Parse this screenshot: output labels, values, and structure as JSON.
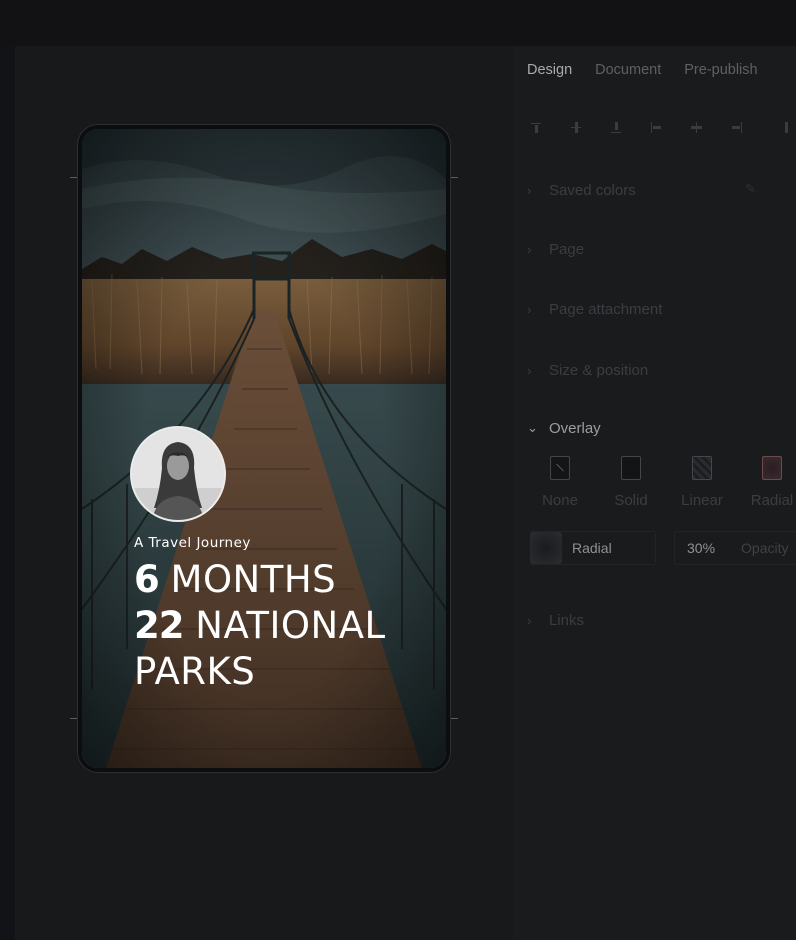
{
  "tabs": [
    {
      "label": "Design",
      "active": true
    },
    {
      "label": "Document",
      "active": false
    },
    {
      "label": "Pre-publish",
      "active": false
    }
  ],
  "toolbar": {
    "icons": [
      "align-top-icon",
      "align-middle-icon",
      "align-bottom-icon",
      "align-left-icon",
      "align-center-icon",
      "align-right-icon",
      "more-align-icon"
    ]
  },
  "sections": {
    "saved_colors": "Saved colors",
    "page": "Page",
    "page_attachment": "Page attachment",
    "size_position": "Size & position",
    "overlay": "Overlay",
    "links": "Links"
  },
  "overlay": {
    "options": [
      {
        "label": "None",
        "icon": "no-overlay-icon"
      },
      {
        "label": "Solid",
        "icon": "solid-overlay-icon"
      },
      {
        "label": "Linear",
        "icon": "linear-overlay-icon"
      },
      {
        "label": "Radial",
        "icon": "radial-overlay-icon",
        "selected": true
      }
    ],
    "type_value": "Radial",
    "opacity_value": "30%",
    "opacity_label": "Opacity"
  },
  "story": {
    "subtitle": "A Travel Journey",
    "line1_num": "6",
    "line1_word": "MONTHS",
    "line2_num": "22",
    "line2_word": "NATIONAL",
    "line3_word": "PARKS"
  },
  "colors": {
    "background": "#161719",
    "panel": "#1a1b1d",
    "text_white": "#ffffff"
  }
}
